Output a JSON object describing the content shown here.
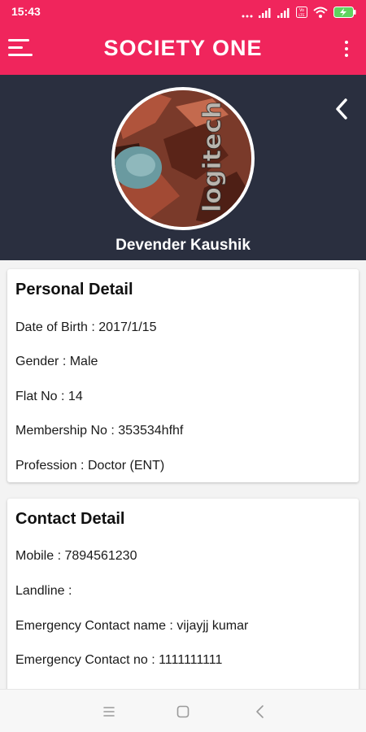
{
  "status_bar": {
    "time": "15:43",
    "icons": [
      "more-dots-icon",
      "signal-icon",
      "signal-icon",
      "volte-icon",
      "wifi-icon",
      "battery-charging-icon"
    ],
    "volte_label": "Vo\nLTE"
  },
  "app_bar": {
    "title": "SOCIETY ONE",
    "accent_color": "#f0255c"
  },
  "profile": {
    "name": "Devender Kaushik",
    "avatar_text": "logitech",
    "header_color": "#2a2f3f"
  },
  "personal_detail": {
    "title": "Personal Detail",
    "rows": [
      {
        "label": "Date of Birth :",
        "value": "2017/1/15"
      },
      {
        "label": "Gender :",
        "value": "Male"
      },
      {
        "label": "Flat No :",
        "value": "14"
      },
      {
        "label": "Membership No :",
        "value": "353534hfhf"
      },
      {
        "label": "Profession :",
        "value": "Doctor (ENT)"
      }
    ]
  },
  "contact_detail": {
    "title": "Contact Detail",
    "rows": [
      {
        "label": "Mobile :",
        "value": "7894561230"
      },
      {
        "label": "Landline :",
        "value": ""
      },
      {
        "label": "Emergency Contact name :",
        "value": "vijayjj kumar"
      },
      {
        "label": "Emergency Contact no :",
        "value": "1111111111"
      }
    ]
  },
  "nav_bar": {
    "buttons": [
      "menu-icon",
      "home-square-icon",
      "back-triangle-icon"
    ]
  }
}
